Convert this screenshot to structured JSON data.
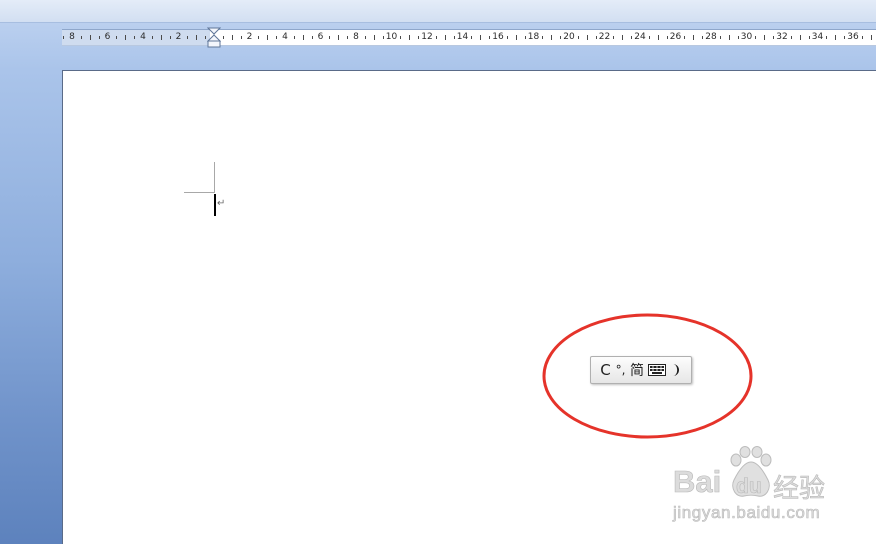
{
  "ruler": {
    "left_labels": [
      8,
      6,
      4,
      2
    ],
    "right_labels": [
      2,
      4,
      6,
      8,
      10,
      12,
      14,
      16,
      18,
      20,
      22,
      24,
      26,
      28,
      30,
      32,
      34,
      36
    ]
  },
  "document": {
    "paragraph_mark": "↵"
  },
  "ime_toolbar": {
    "mode_label": "C",
    "punctuation_label": "°,",
    "charset_label": "简",
    "soft_keyboard_icon": "soft-keyboard-icon",
    "width_mode_icon": "half-width-moon-icon"
  },
  "watermark": {
    "brand_part1": "Bai",
    "brand_part2": "du",
    "brand_suffix": "经验",
    "url": "jingyan.baidu.com",
    "logo_icon": "baidu-paw-icon"
  },
  "icons": {
    "indent_marker": "indent-marker-icon"
  },
  "colors": {
    "highlight_ellipse": "#e5332a",
    "page": "#ffffff",
    "ruler_margin": "#cfdcef",
    "workspace_top": "#c2d5f1",
    "workspace_bottom": "#5d82bd"
  }
}
